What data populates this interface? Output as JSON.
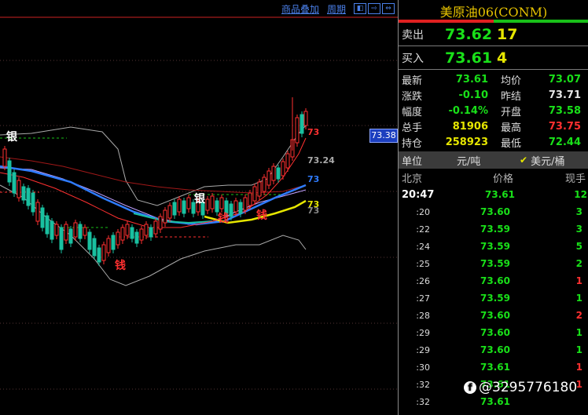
{
  "toolbar": {
    "overlay_label": "商品叠加",
    "period_label": "周期",
    "nav_icons": [
      "arrow-left-icon",
      "arrow-right-icon",
      "arrow-both-icon"
    ]
  },
  "chart": {
    "price_tag": "73.38",
    "ma_labels": [
      {
        "text": "73",
        "color": "#ff3030"
      },
      {
        "text": "73.24",
        "color": "#aaaaaa"
      },
      {
        "text": "73",
        "color": "#2f7cff"
      },
      {
        "text": "73",
        "color": "#e6e600"
      },
      {
        "text": "73",
        "color": "#888888"
      }
    ],
    "annotations": [
      "银",
      "银",
      "钱",
      "钱",
      "钱"
    ],
    "colors": {
      "up": "#ff3030",
      "down": "#19c0a0",
      "ma_fast": "#ff3030",
      "ma_mid": "#2f7cff",
      "ma_slow": "#e6e600",
      "band": "#aaaaaa"
    }
  },
  "panel": {
    "title": "美原油06(CONM)",
    "ask": {
      "label": "卖出",
      "price": "73.62",
      "volume": "17"
    },
    "bid": {
      "label": "买入",
      "price": "73.61",
      "volume": "4"
    },
    "stats": [
      {
        "k": "最新",
        "v": "73.61",
        "vc": "g",
        "k2": "均价",
        "v2": "73.07",
        "v2c": "g"
      },
      {
        "k": "涨跌",
        "v": "-0.10",
        "vc": "g",
        "k2": "昨结",
        "v2": "73.71",
        "v2c": "w"
      },
      {
        "k": "幅度",
        "v": "-0.14%",
        "vc": "g",
        "k2": "开盘",
        "v2": "73.58",
        "v2c": "g"
      },
      {
        "k": "总手",
        "v": "81906",
        "vc": "y",
        "k2": "最高",
        "v2": "73.75",
        "v2c": "r"
      },
      {
        "k": "持仓",
        "v": "258923",
        "vc": "y",
        "k2": "最低",
        "v2": "72.44",
        "v2c": "g"
      }
    ],
    "unit": {
      "label": "单位",
      "unit1": "元/吨",
      "unit2": "美元/桶"
    },
    "tick_header": {
      "c1": "北京",
      "c2": "价格",
      "c3": "现手"
    },
    "ticks": [
      {
        "t": "20:47",
        "p": "73.61",
        "pc": "g",
        "q": "12",
        "qc": "g",
        "main": true
      },
      {
        "t": ":20",
        "p": "73.60",
        "pc": "g",
        "q": "3",
        "qc": "g"
      },
      {
        "t": ":22",
        "p": "73.59",
        "pc": "g",
        "q": "3",
        "qc": "g"
      },
      {
        "t": ":24",
        "p": "73.59",
        "pc": "g",
        "q": "5",
        "qc": "g"
      },
      {
        "t": ":25",
        "p": "73.59",
        "pc": "g",
        "q": "2",
        "qc": "g"
      },
      {
        "t": ":26",
        "p": "73.60",
        "pc": "g",
        "q": "1",
        "qc": "r"
      },
      {
        "t": ":27",
        "p": "73.59",
        "pc": "g",
        "q": "1",
        "qc": "g"
      },
      {
        "t": ":28",
        "p": "73.60",
        "pc": "g",
        "q": "2",
        "qc": "r"
      },
      {
        "t": ":29",
        "p": "73.60",
        "pc": "g",
        "q": "1",
        "qc": "g"
      },
      {
        "t": ":29",
        "p": "73.60",
        "pc": "g",
        "q": "1",
        "qc": "g"
      },
      {
        "t": ":30",
        "p": "73.61",
        "pc": "g",
        "q": "1",
        "qc": "r"
      },
      {
        "t": ":32",
        "p": "73.61",
        "pc": "g",
        "q": "1",
        "qc": "r"
      },
      {
        "t": ":32",
        "p": "73.61",
        "pc": "g",
        "q": "",
        "qc": "g"
      }
    ]
  },
  "watermark": {
    "icon": "facebook-icon",
    "text": "@3295776180"
  }
}
